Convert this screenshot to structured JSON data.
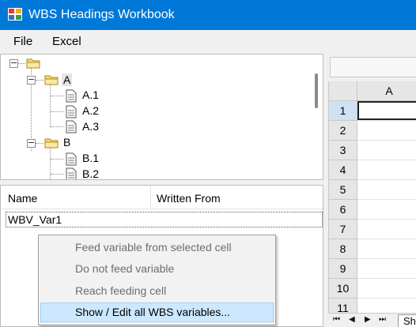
{
  "window": {
    "title": "WBS Headings Workbook"
  },
  "menu": {
    "file": "File",
    "excel": "Excel"
  },
  "tree": {
    "root_label": "",
    "nodes": [
      {
        "label": "A",
        "children": [
          "A.1",
          "A.2",
          "A.3"
        ]
      },
      {
        "label": "B",
        "children": [
          "B.1",
          "B.2"
        ]
      }
    ],
    "expander_symbol": "−"
  },
  "variables": {
    "columns": [
      "Name",
      "Written From"
    ],
    "rows": [
      {
        "name": "WBV_Var1",
        "written_from": ""
      }
    ]
  },
  "context_menu": {
    "items": [
      {
        "label": "Feed variable from selected cell",
        "enabled": false
      },
      {
        "label": "Do not feed variable",
        "enabled": false
      },
      {
        "label": "Reach feeding cell",
        "enabled": false
      },
      {
        "label": "Show / Edit all WBS variables...",
        "enabled": true,
        "highlighted": true
      }
    ]
  },
  "spreadsheet": {
    "column_headers": [
      "A"
    ],
    "row_headers": [
      "1",
      "2",
      "3",
      "4",
      "5",
      "6",
      "7",
      "8",
      "9",
      "10",
      "11"
    ],
    "selected_cell": "A1",
    "sheet_tab": "Sh",
    "nav": [
      "⏮",
      "◀",
      "▶",
      "⏭"
    ]
  },
  "colors": {
    "titlebar": "#0078d7",
    "highlight": "#cce8ff",
    "selected_row_header": "#cfe2f3"
  }
}
